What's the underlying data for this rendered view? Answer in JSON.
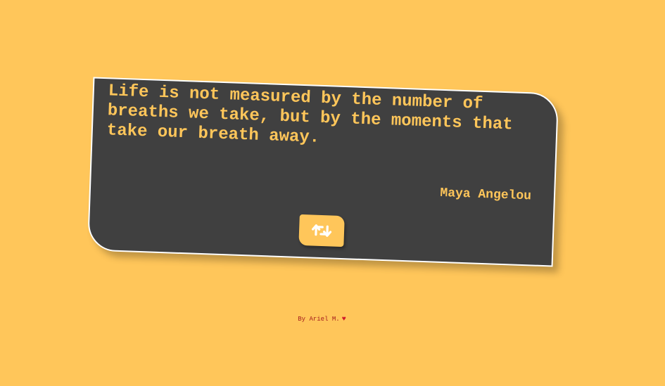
{
  "quote": {
    "text": "Life is not measured by the number of breaths we take, but by the moments that take our breath away.",
    "author": "Maya Angelou"
  },
  "new_quote_button": {
    "icon": "retweet-icon"
  },
  "footer": {
    "credit": "By Ariel M.",
    "heart_icon": "♥"
  },
  "colors": {
    "background": "#ffc65a",
    "card": "#404040",
    "accent": "#ffc65a",
    "footer_text": "#a51c1c"
  }
}
